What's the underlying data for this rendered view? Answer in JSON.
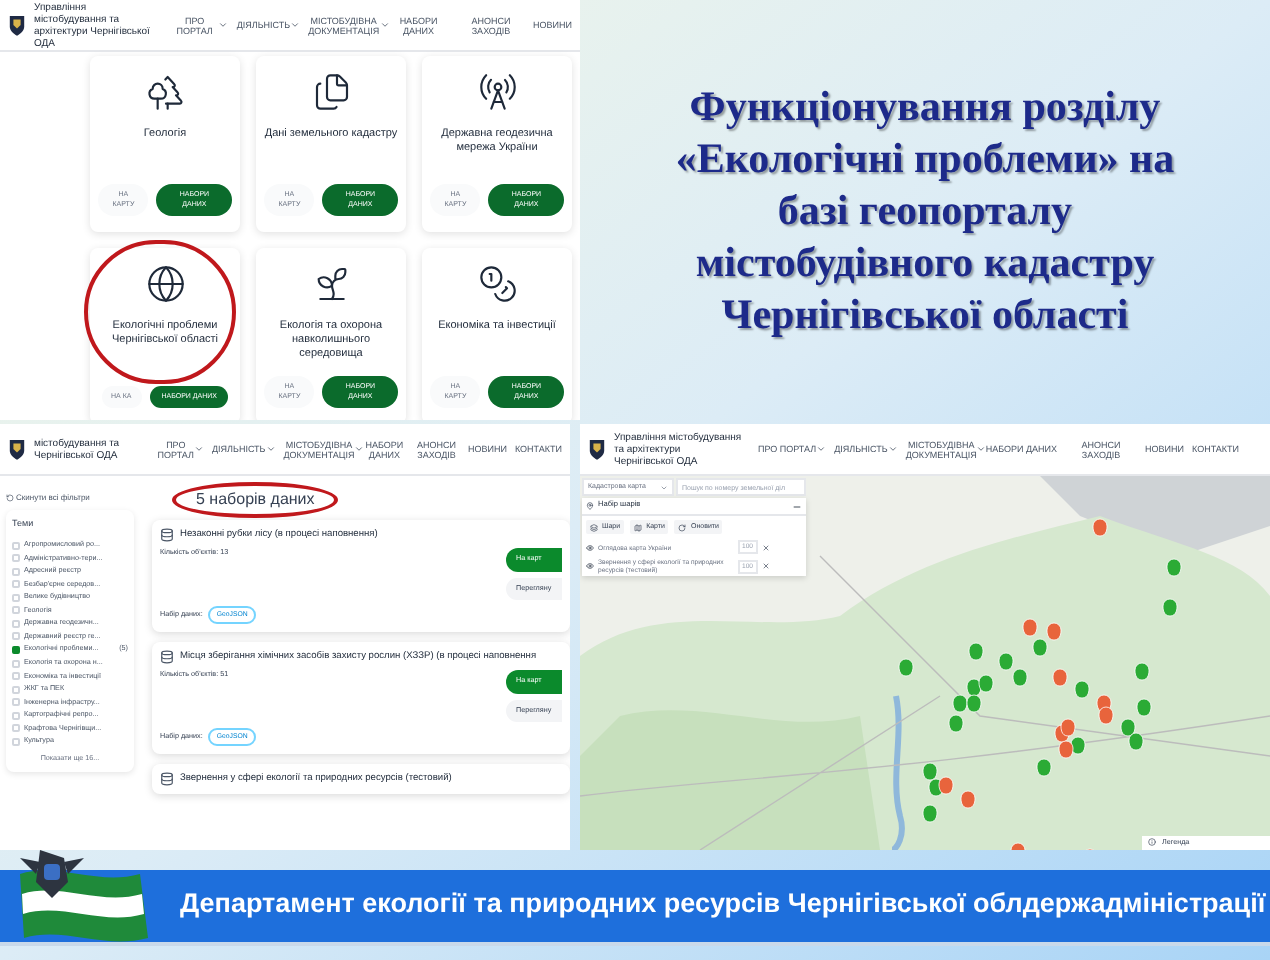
{
  "top_screenshot": {
    "header": {
      "org": "Управління містобудування та архітектури Чернігівської ОДА",
      "nav": [
        {
          "label": "ПРО ПОРТАЛ",
          "dropdown": true
        },
        {
          "label": "ДІЯЛЬНІСТЬ",
          "dropdown": true
        },
        {
          "label": "МІСТОБУДІВНА ДОКУМЕНТАЦІЯ",
          "dropdown": true
        },
        {
          "label": "НАБОРИ ДАНИХ",
          "dropdown": false
        },
        {
          "label": "АНОНСИ ЗАХОДІВ",
          "dropdown": false
        },
        {
          "label": "НОВИНИ",
          "dropdown": false
        }
      ]
    },
    "cards": [
      {
        "title": "Геологія",
        "map_button": "НА КАРТУ",
        "data_button": "НАБОРИ ДАНИХ",
        "highlighted": false
      },
      {
        "title": "Дані земельного кадастру",
        "map_button": "НА КАРТУ",
        "data_button": "НАБОРИ ДАНИХ",
        "highlighted": false
      },
      {
        "title": "Державна геодезична мережа України",
        "map_button": "НА КАРТУ",
        "data_button": "НАБОРИ ДАНИХ",
        "highlighted": false
      },
      {
        "title": "Екологічні проблеми Чернігівської області",
        "map_button": "НА КА",
        "data_button": "НАБОРИ ДАНИХ",
        "highlighted": true
      },
      {
        "title": "Екологія та охорона навколишнього середовища",
        "map_button": "НА КАРТУ",
        "data_button": "НАБОРИ ДАНИХ",
        "highlighted": false
      },
      {
        "title": "Економіка та інвестиції",
        "map_button": "НА КАРТУ",
        "data_button": "НАБОРИ ДАНИХ",
        "highlighted": false
      }
    ]
  },
  "title": "Функціонування розділу\n«Екологічні проблеми» на\nбазі геопорталу\nмістобудівного кадастру\nЧернігівської області",
  "datasets_screenshot": {
    "header": {
      "org": "містобудування та\nЧернігівської ОДА",
      "nav": [
        {
          "label": "ПРО ПОРТАЛ",
          "dropdown": true
        },
        {
          "label": "ДІЯЛЬНІСТЬ",
          "dropdown": true
        },
        {
          "label": "МІСТОБУДІВНА ДОКУМЕНТАЦІЯ",
          "dropdown": true
        },
        {
          "label": "НАБОРИ ДАНИХ",
          "dropdown": false
        },
        {
          "label": "АНОНСИ ЗАХОДІВ",
          "dropdown": false
        },
        {
          "label": "НОВИНИ",
          "dropdown": false
        },
        {
          "label": "КОНТАКТИ",
          "dropdown": false
        }
      ]
    },
    "reset_filters": "Скинути всі фільтри",
    "themes_heading": "Теми",
    "themes": [
      {
        "label": "Агропромисловий ро...",
        "checked": false
      },
      {
        "label": "Адміністративно-тери...",
        "checked": false
      },
      {
        "label": "Адресний реєстр",
        "checked": false
      },
      {
        "label": "Безбар'єрне середов...",
        "checked": false
      },
      {
        "label": "Велике будівництво",
        "checked": false
      },
      {
        "label": "Геологія",
        "checked": false
      },
      {
        "label": "Державна геодезичн...",
        "checked": false
      },
      {
        "label": "Державний реєстр ге...",
        "checked": false
      },
      {
        "label": "Екологічні проблеми...",
        "checked": true,
        "count": "(5)"
      },
      {
        "label": "Екологія та охорона н...",
        "checked": false
      },
      {
        "label": "Економіка та інвестиції",
        "checked": false
      },
      {
        "label": "ЖКГ та ПЕК",
        "checked": false
      },
      {
        "label": "Інженерна інфрастру...",
        "checked": false
      },
      {
        "label": "Картографічні репро...",
        "checked": false
      },
      {
        "label": "Крафтова Чернігівщи...",
        "checked": false
      },
      {
        "label": "Культура",
        "checked": false
      }
    ],
    "show_more": "Показати ще 16...",
    "count": "5 наборів даних",
    "count_highlighted": true,
    "items": [
      {
        "title": "Незаконні рубки лісу (в процесі наповнення)",
        "objects": "Кількість об'єктів: 13",
        "map_button": "На карт",
        "view_button": "Перегляну",
        "format_label": "Набір даних:",
        "format": "GeoJSON"
      },
      {
        "title": "Місця зберігання хімічних засобів захисту рослин (ХЗЗР) (в процесі наповнення",
        "objects": "Кількість об'єктів: 51",
        "map_button": "На карт",
        "view_button": "Перегляну",
        "format_label": "Набір даних:",
        "format": "GeoJSON"
      },
      {
        "title": "Звернення у сфері екології та природних ресурсів (тестовий)"
      }
    ]
  },
  "map_screenshot": {
    "header": {
      "org": "Управління містобудування та архітектури Чернігівської ОДА",
      "nav": [
        {
          "label": "ПРО ПОРТАЛ",
          "dropdown": true
        },
        {
          "label": "ДІЯЛЬНІСТЬ",
          "dropdown": true
        },
        {
          "label": "МІСТОБУДІВНА ДОКУМЕНТАЦІЯ",
          "dropdown": true
        },
        {
          "label": "НАБОРИ ДАНИХ",
          "dropdown": false
        },
        {
          "label": "АНОНСИ ЗАХОДІВ",
          "dropdown": false
        },
        {
          "label": "НОВИНИ",
          "dropdown": false
        },
        {
          "label": "КОНТАКТИ",
          "dropdown": false
        }
      ]
    },
    "basemap_select": "Кадастрова карта",
    "search_placeholder": "Пошук по номеру земельної діл",
    "layers_title": "Набір шарів",
    "tools": [
      "Шари",
      "Карти",
      "Оновити"
    ],
    "layers": [
      {
        "name": "Оглядова карта України",
        "visible": true,
        "opacity": "100"
      },
      {
        "name": "Звернення у сфері екології та природних ресурсів (тестовий)",
        "visible": true,
        "opacity": "100"
      }
    ],
    "legend": "Легенда"
  },
  "footer": "Департамент екології та природних ресурсів Чернігівської облдержадміністрації"
}
